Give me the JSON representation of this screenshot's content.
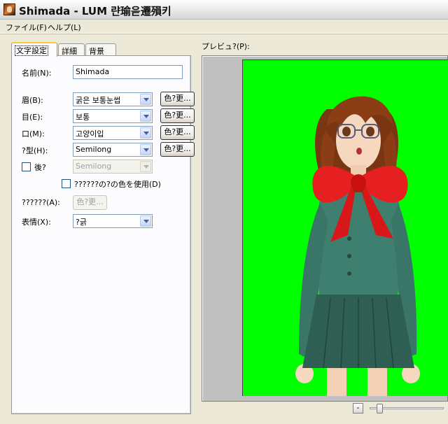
{
  "window": {
    "title": "Shimada - LUM 랸瑜읃遷殞키"
  },
  "menu": {
    "file": "ファイル(F)",
    "help": "ヘルプ(L)"
  },
  "tabs": [
    "文字設定",
    "詳細",
    "背景"
  ],
  "form": {
    "name_label": "名前(N):",
    "name_value": "Shimada",
    "eyebrow_label": "眉(B):",
    "eyebrow_value": "굵은 보통눈썹",
    "eye_label": "目(E):",
    "eye_value": "보통",
    "mouth_label": "口(M):",
    "mouth_value": "고양이입",
    "hair_label": "?型(H):",
    "hair_value": "Semilong",
    "back_label": "後?",
    "back_value": "Semilong",
    "same_color_label": "??????の?の色を使用(D)",
    "accessory_label": "??????(A):",
    "expression_label": "表情(X):",
    "expression_value": "?긁",
    "color_button": "色?更..."
  },
  "preview": {
    "label": "プレビュ?(P):",
    "background_color": "#00ff00",
    "zoom_minus": "-",
    "zoom_level": 0.1
  }
}
